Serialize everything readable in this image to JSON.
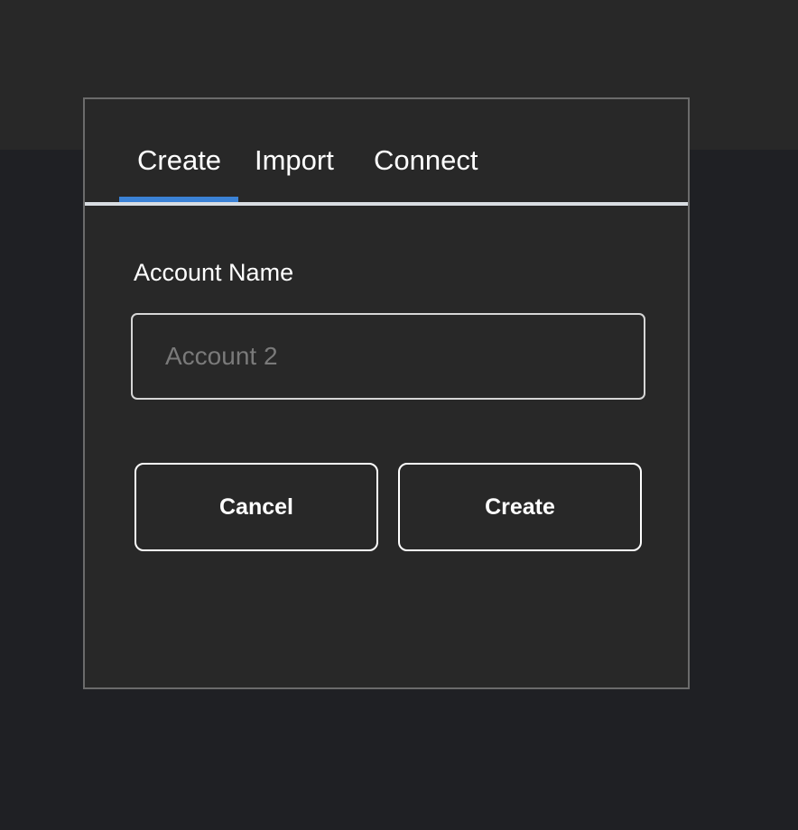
{
  "tabs": [
    {
      "label": "Create",
      "active": true
    },
    {
      "label": "Import",
      "active": false
    },
    {
      "label": "Connect",
      "active": false
    }
  ],
  "form": {
    "account_name_label": "Account Name",
    "account_name_placeholder": "Account 2",
    "account_name_value": ""
  },
  "actions": {
    "cancel_label": "Cancel",
    "create_label": "Create"
  },
  "colors": {
    "accent": "#3b82d6",
    "modal_background": "#282828",
    "page_background": "#1f2024"
  }
}
